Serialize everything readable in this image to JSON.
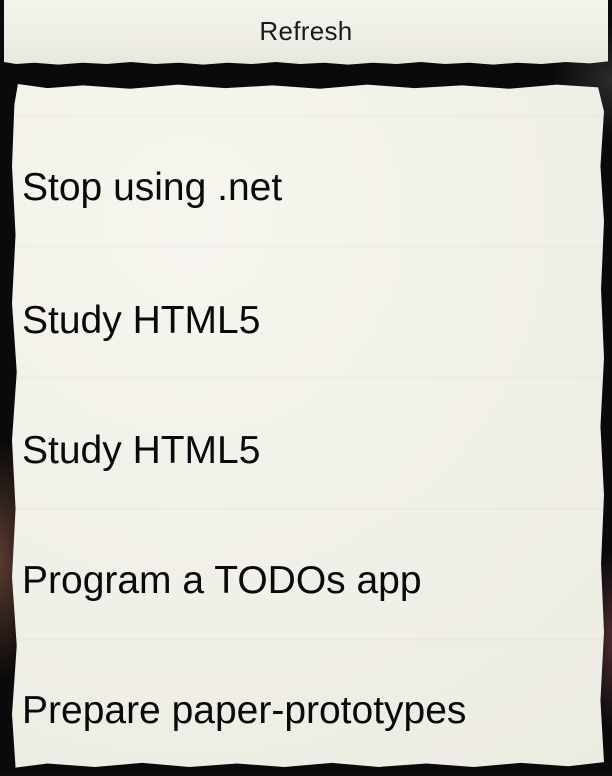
{
  "toolbar": {
    "refresh_label": "Refresh"
  },
  "todos": [
    {
      "label": "Stop using .net"
    },
    {
      "label": "Study HTML5"
    },
    {
      "label": "Study HTML5"
    },
    {
      "label": "Program a TODOs app"
    },
    {
      "label": "Prepare paper-prototypes"
    }
  ],
  "colors": {
    "paper": "#f1f0e8",
    "background": "#0a0a0a",
    "text": "#0a0a0a"
  }
}
